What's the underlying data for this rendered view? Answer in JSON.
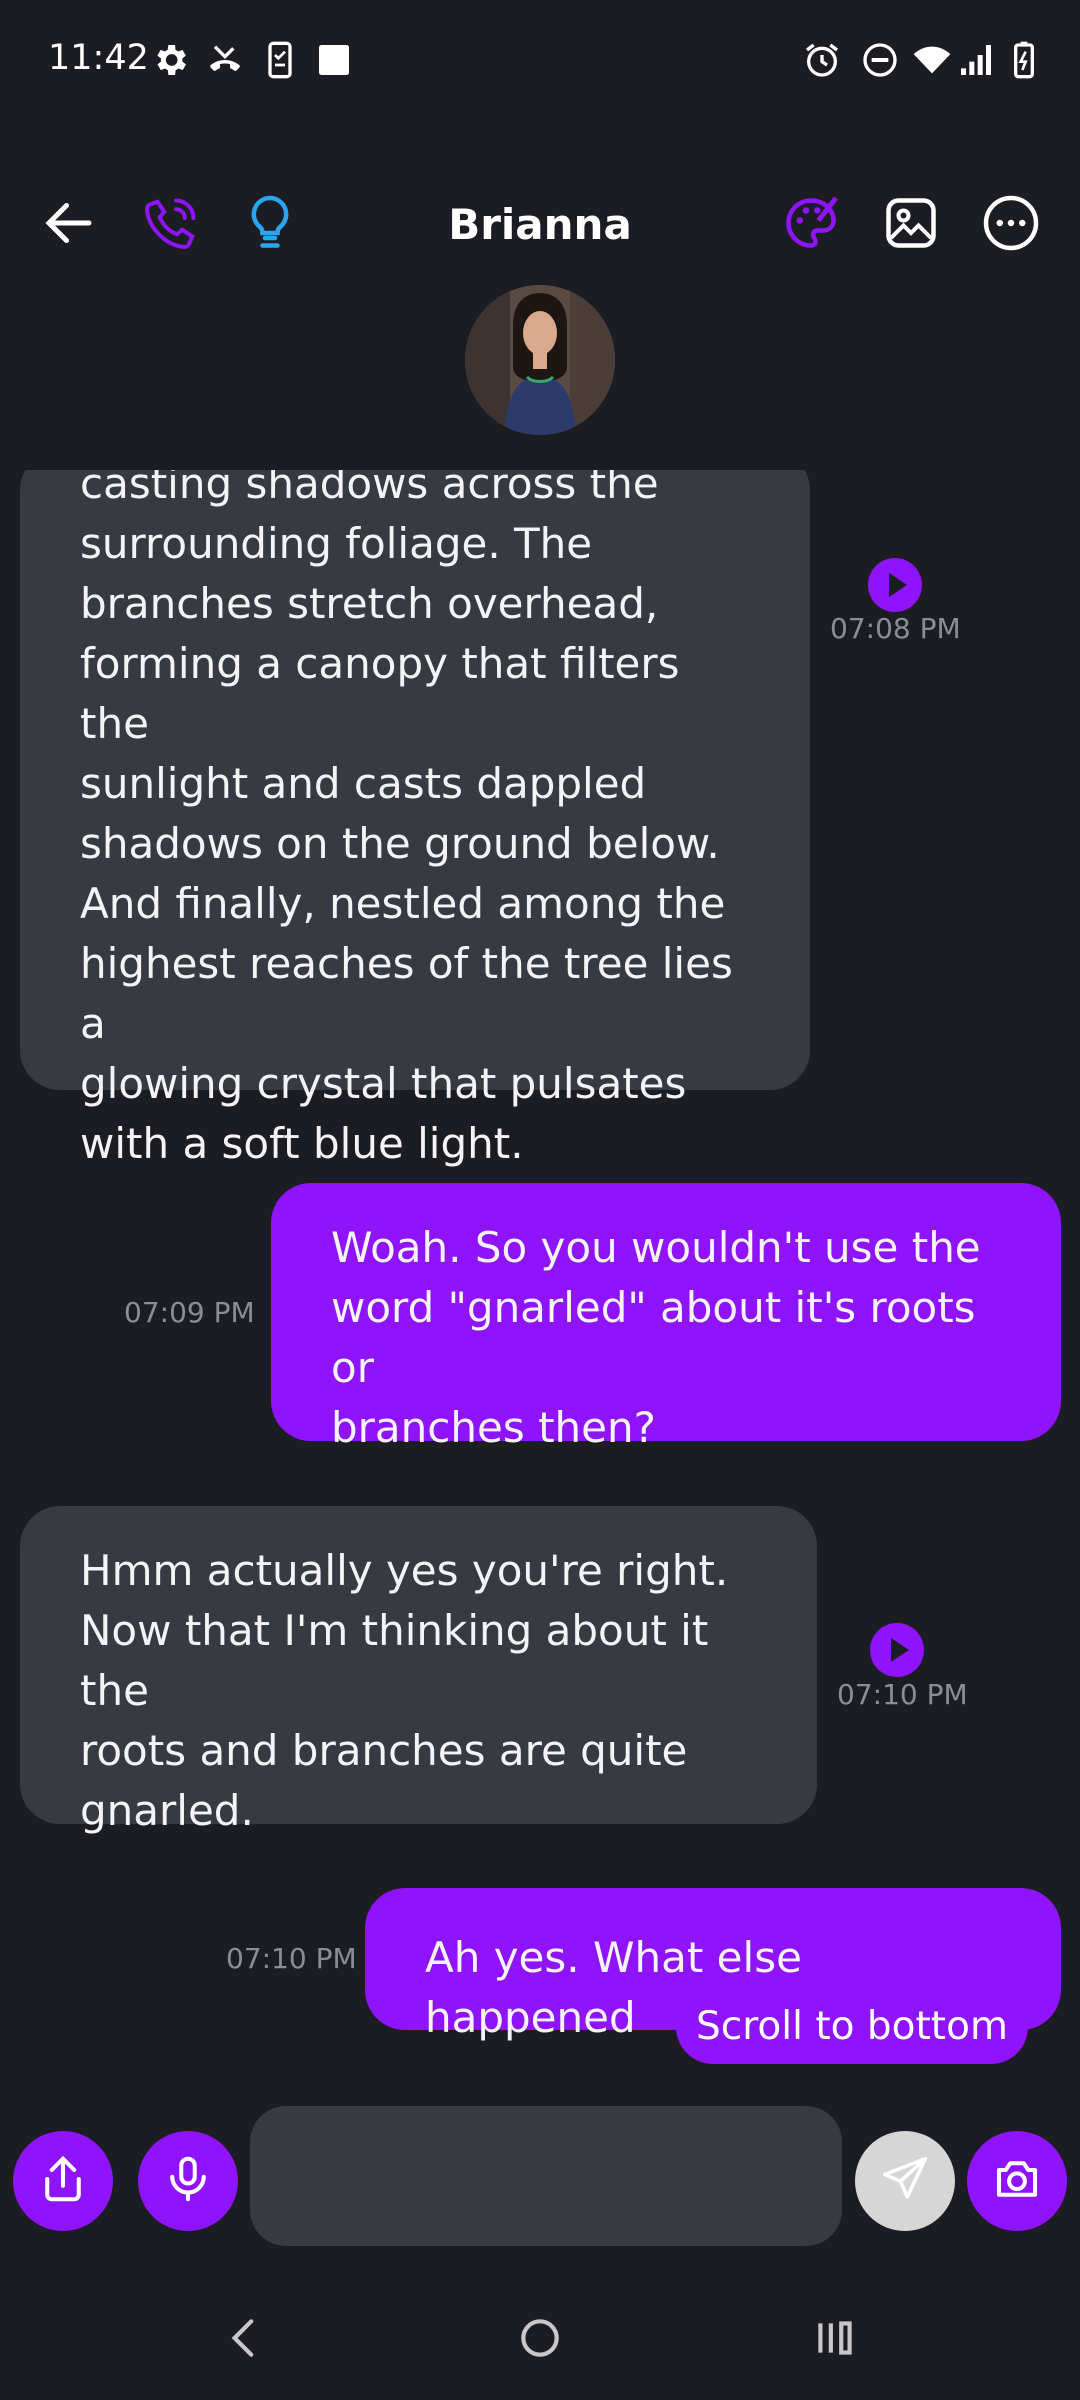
{
  "status_bar": {
    "time": "11:42",
    "left_icons": [
      "gear-icon",
      "missed-call-icon",
      "phone-checklist-icon",
      "square-notification-icon"
    ],
    "right_icons": [
      "alarm-icon",
      "do-not-disturb-icon",
      "wifi-icon",
      "signal-icon",
      "battery-charging-icon"
    ]
  },
  "header": {
    "title": "Brianna",
    "left_icons": [
      "back-arrow-icon",
      "phone-call-icon",
      "lightbulb-icon"
    ],
    "right_icons": [
      "palette-icon",
      "image-icon",
      "more-options-icon"
    ]
  },
  "messages": [
    {
      "direction": "incoming",
      "text": "casting shadows across the\nsurrounding foliage. The\nbranches stretch overhead,\nforming a canopy that filters the\nsunlight and casts dappled\nshadows on the ground below.\nAnd finally, nestled among the\nhighest reaches of the tree lies a\nglowing crystal that pulsates\nwith a soft blue light.",
      "time": "07:08 PM",
      "has_play": true
    },
    {
      "direction": "outgoing",
      "text": "Woah. So you wouldn't use the\nword \"gnarled\" about it's roots or\nbranches then?",
      "time": "07:09 PM"
    },
    {
      "direction": "incoming",
      "text": "Hmm actually yes you're right.\nNow that I'm thinking about it the\nroots and branches are quite\ngnarled.",
      "time": "07:10 PM",
      "has_play": true
    },
    {
      "direction": "outgoing",
      "text": "Ah yes. What else happened",
      "time": "07:10 PM"
    }
  ],
  "scroll_to_bottom_label": "Scroll to bottom",
  "composer": {
    "input_value": "",
    "placeholder": "",
    "icons": [
      "share-icon",
      "microphone-icon",
      "send-icon",
      "camera-icon"
    ]
  },
  "nav_bar": {
    "icons": [
      "nav-back-icon",
      "nav-home-icon",
      "nav-recents-icon"
    ]
  },
  "colors": {
    "background": "#1c1d22",
    "incoming_bubble": "#383a42",
    "outgoing_bubble": "#9014fb",
    "accent_purple": "#9014fb",
    "accent_blue": "#2aa6f0",
    "timestamp": "#8b8d95"
  }
}
